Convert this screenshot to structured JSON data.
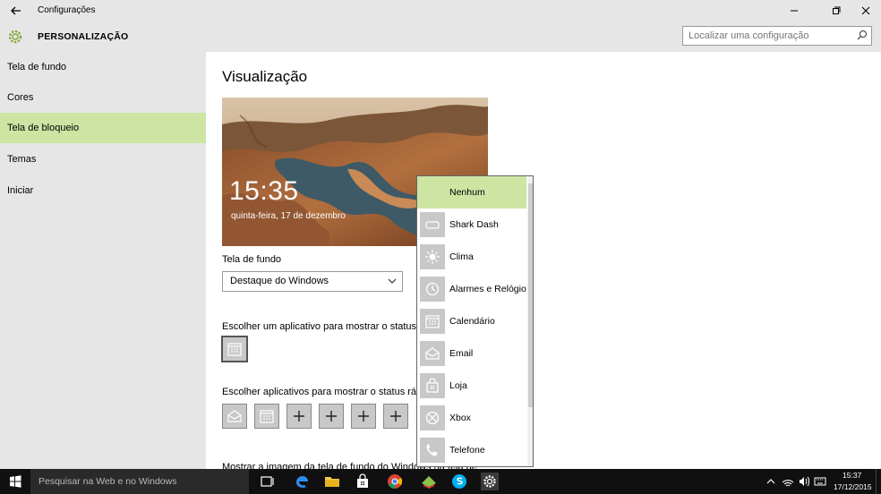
{
  "window": {
    "title": "Configurações"
  },
  "header": {
    "section_title": "PERSONALIZAÇÃO",
    "search_placeholder": "Localizar uma configuração"
  },
  "sidebar": {
    "items": [
      {
        "label": "Tela de fundo",
        "active": false
      },
      {
        "label": "Cores",
        "active": false
      },
      {
        "label": "Tela de bloqueio",
        "active": true
      },
      {
        "label": "Temas",
        "active": false
      },
      {
        "label": "Iniciar",
        "active": false
      }
    ]
  },
  "main": {
    "heading": "Visualização",
    "preview": {
      "time": "15:35",
      "date": "quinta-feira, 17 de dezembro"
    },
    "background_label": "Tela de fundo",
    "background_value": "Destaque do Windows",
    "detailed_status_label": "Escolher um aplicativo para mostrar o status d",
    "quick_status_label": "Escolher aplicativos para mostrar o status ráp",
    "bottom_label": "Mostrar a imagem da tela de fundo do Windows na tela de"
  },
  "popup": {
    "items": [
      {
        "label": "Nenhum",
        "icon": "none"
      },
      {
        "label": "Shark Dash",
        "icon": "shark-dash-icon"
      },
      {
        "label": "Clima",
        "icon": "weather-icon"
      },
      {
        "label": "Alarmes e Relógio",
        "icon": "alarm-clock-icon"
      },
      {
        "label": "Calendário",
        "icon": "calendar-icon"
      },
      {
        "label": "Email",
        "icon": "mail-icon"
      },
      {
        "label": "Loja",
        "icon": "store-icon"
      },
      {
        "label": "Xbox",
        "icon": "xbox-icon"
      },
      {
        "label": "Telefone",
        "icon": "phone-icon"
      }
    ]
  },
  "taskbar": {
    "search_placeholder": "Pesquisar na Web e no Windows",
    "clock_time": "15:37",
    "clock_date": "17/12/2015"
  },
  "colors": {
    "accent": "#cde4a3",
    "chrome": "#e6e6e6",
    "taskbar": "#101010"
  }
}
